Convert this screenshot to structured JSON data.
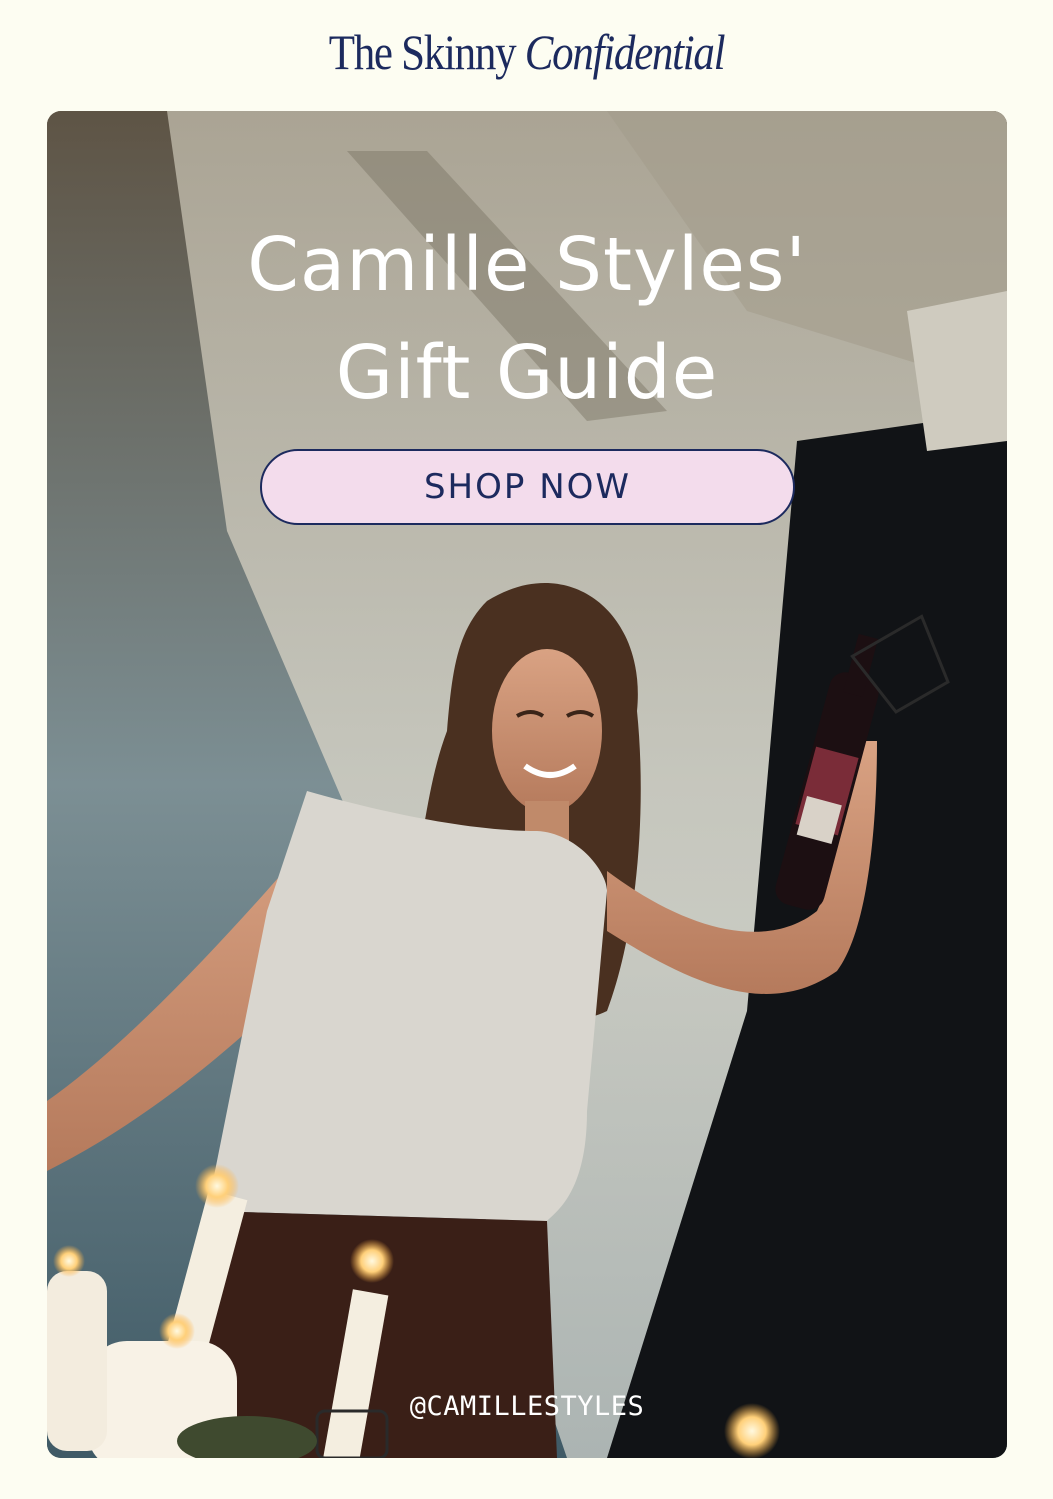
{
  "header": {
    "logo_part1": "The Skinny ",
    "logo_part2": "Confidential"
  },
  "hero": {
    "title_line1": "Camille Styles'",
    "title_line2": "Gift Guide",
    "cta_label": "SHOP NOW",
    "credit": "@CAMILLESTYLES"
  },
  "colors": {
    "background": "#fdfdf2",
    "brand_navy": "#1c2a5e",
    "button_pink": "#f3dcec"
  }
}
